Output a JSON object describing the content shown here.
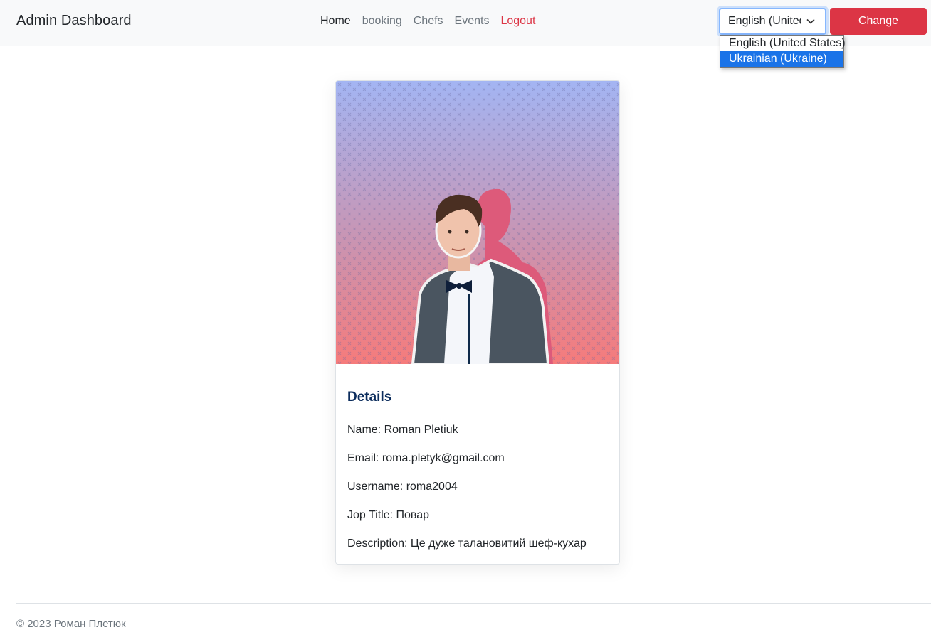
{
  "navbar": {
    "brand": "Admin Dashboard",
    "links": [
      "Home",
      "booking",
      "Chefs",
      "Events",
      "Logout"
    ]
  },
  "language": {
    "selected_display": "English (United States)",
    "options": [
      "English (United States)",
      "Ukrainian (Ukraine)"
    ],
    "highlighted_option": "Ukrainian (Ukraine)",
    "change_label": "Change"
  },
  "card": {
    "title": "Details",
    "name": "Name: Roman Pletiuk",
    "email": "Email: roma.pletyk@gmail.com",
    "username": "Username: roma2004",
    "job_title": "Jop Title: Повар",
    "description": "Description: Це дуже талановитий шеф-кухар"
  },
  "footer": {
    "copyright": "© 2023 Роман Плетюк"
  },
  "colors": {
    "accent_red": "#dc3545",
    "highlight_blue": "#1a73e8",
    "title_navy": "#0b2c5c",
    "photo_top": "#a3b5f3",
    "photo_bottom": "#f67b7b"
  },
  "icons": [
    "chevron-down-icon"
  ]
}
